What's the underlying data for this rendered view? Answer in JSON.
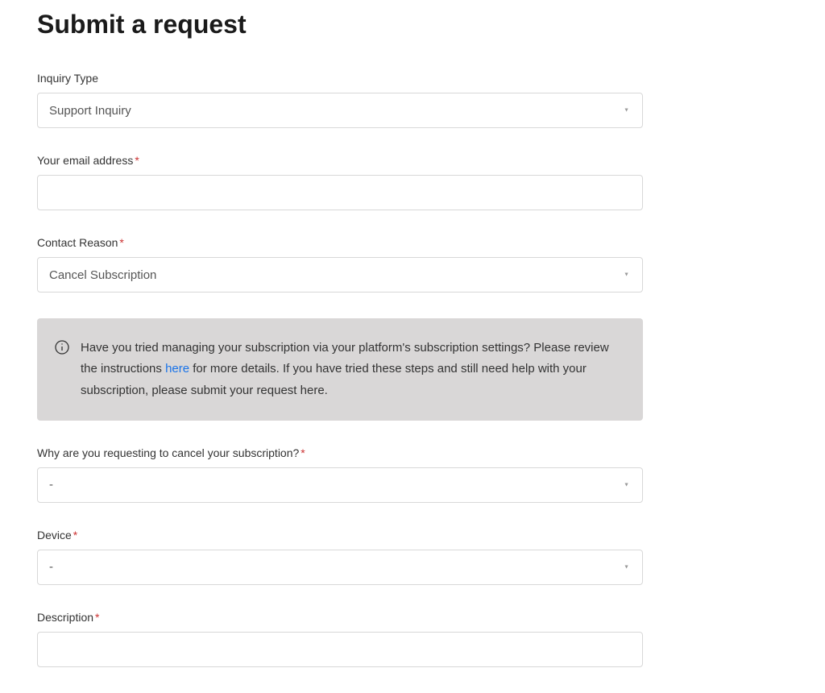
{
  "title": "Submit a request",
  "fields": {
    "inquiry_type": {
      "label": "Inquiry Type",
      "value": "Support Inquiry"
    },
    "email": {
      "label": "Your email address",
      "value": ""
    },
    "contact_reason": {
      "label": "Contact Reason",
      "value": "Cancel Subscription"
    },
    "cancel_reason": {
      "label": "Why are you requesting to cancel your subscription?",
      "value": "-"
    },
    "device": {
      "label": "Device",
      "value": "-"
    },
    "description": {
      "label": "Description",
      "value": ""
    }
  },
  "info": {
    "text_before": "Have you tried managing your subscription via your platform's subscription settings? Please review the instructions ",
    "link_text": "here",
    "text_after": " for more details. If you have tried these steps and still need help with your subscription, please submit your request here."
  },
  "required_mark": "*"
}
